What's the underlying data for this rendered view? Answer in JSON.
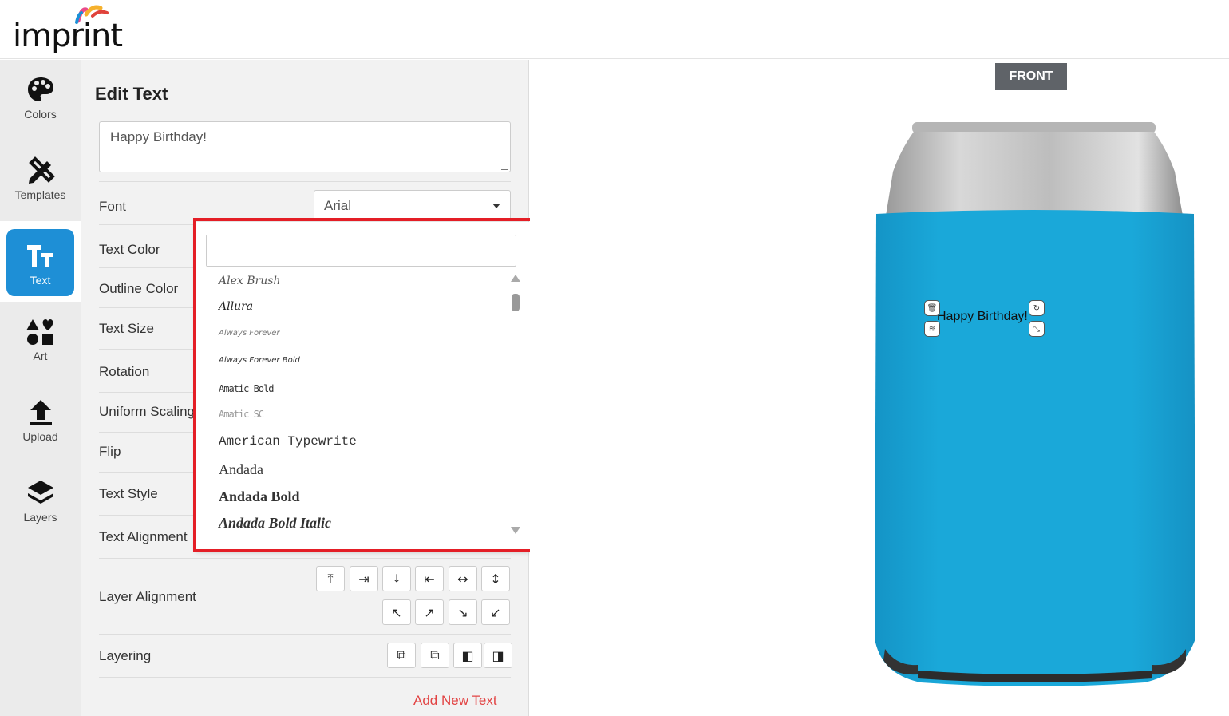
{
  "header": {
    "logo_text": "imprint"
  },
  "nav": {
    "items": [
      {
        "label": "Colors",
        "icon": "palette-icon"
      },
      {
        "label": "Templates",
        "icon": "pencil-ruler-icon"
      },
      {
        "label": "Text",
        "icon": "text-icon",
        "active": true
      },
      {
        "label": "Art",
        "icon": "shapes-icon"
      },
      {
        "label": "Upload",
        "icon": "upload-icon"
      },
      {
        "label": "Layers",
        "icon": "layers-icon"
      }
    ]
  },
  "panel": {
    "title": "Edit Text",
    "text_value": "Happy Birthday!",
    "rows": {
      "font": "Font",
      "text_color": "Text Color",
      "outline_color": "Outline Color",
      "text_size": "Text Size",
      "rotation": "Rotation",
      "uniform_scaling": "Uniform Scaling",
      "flip": "Flip",
      "text_style": "Text Style",
      "text_alignment": "Text Alignment",
      "layer_alignment": "Layer Alignment",
      "layering": "Layering"
    },
    "font_selected": "Arial",
    "layer_alignment_icons": [
      "⤒",
      "⇥",
      "⤓",
      "⇤",
      "↔",
      "↕",
      "↖",
      "↗",
      "↘",
      "↙"
    ],
    "layering_icons": [
      "⧉",
      "⧉",
      "◧",
      "◨"
    ],
    "add_new_text": "Add New Text"
  },
  "font_dropdown": {
    "search_value": "",
    "options": [
      "Alex Brush",
      "Allura",
      "Always Forever",
      "Always Forever Bold",
      "Amatic Bold",
      "Amatic SC",
      "American Typewrite",
      "Andada",
      "Andada Bold",
      "Andada Bold Italic"
    ]
  },
  "canvas": {
    "side_label": "FRONT",
    "design_text": "Happy Birthday!",
    "colors": {
      "koozie": "#1aa8d9",
      "can_top": "#c7c7c7"
    }
  }
}
